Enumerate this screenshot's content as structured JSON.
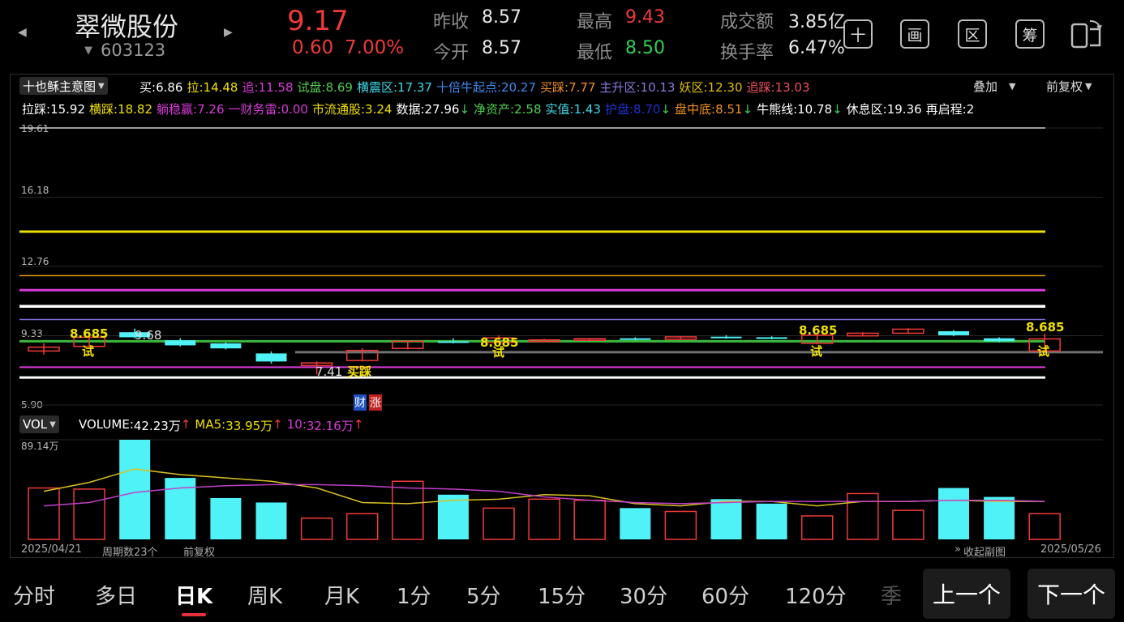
{
  "header": {
    "name": "翠微股份",
    "code": "603123",
    "price": "9.17",
    "change": "0.60",
    "change_pct": "7.00%",
    "quote": {
      "prev_close_label": "昨收",
      "prev_close": "8.57",
      "open_label": "今开",
      "open": "8.57",
      "high_label": "最高",
      "high": "9.43",
      "low_label": "最低",
      "low": "8.50",
      "turnover_amt_label": "成交额",
      "turnover_amt": "3.85亿",
      "turnover_rate_label": "换手率",
      "turnover_rate": "6.47%"
    },
    "tools": [
      "十",
      "画",
      "区",
      "筹"
    ]
  },
  "indicator": {
    "name": "十也稣主意图",
    "overlay": "叠加",
    "adjust": "前复权",
    "row1": [
      {
        "label": "买:",
        "value": "6.86",
        "color": "#ffffff"
      },
      {
        "label": "拉:",
        "value": "14.48",
        "color": "#f0e000"
      },
      {
        "label": "追:",
        "value": "11.58",
        "color": "#d83bd8"
      },
      {
        "label": "试盘:",
        "value": "8.69",
        "color": "#4fd04f"
      },
      {
        "label": "横震区:",
        "value": "17.37",
        "color": "#3fd8e8"
      },
      {
        "label": "十倍牛起点:",
        "value": "20.27",
        "color": "#3a8cf0"
      },
      {
        "label": "买踩:",
        "value": "7.77",
        "color": "#f09020"
      },
      {
        "label": "主升区:",
        "value": "10.13",
        "color": "#8a7ae0"
      },
      {
        "label": "妖区:",
        "value": "12.30",
        "color": "#e0c000"
      },
      {
        "label": "追踩:",
        "value": "13.03",
        "color": "#f05060"
      }
    ],
    "row2": [
      {
        "label": "拉踩:",
        "value": "15.92",
        "color": "#ffffff",
        "arrow": ""
      },
      {
        "label": "横踩:",
        "value": "18.82",
        "color": "#f0e000",
        "arrow": ""
      },
      {
        "label": "躺稳赢:",
        "value": "7.26",
        "color": "#d83bd8",
        "arrow": ""
      },
      {
        "label": "一财务雷:",
        "value": "0.00",
        "color": "#d83bd8",
        "arrow": ""
      },
      {
        "label": "市流通股:",
        "value": "3.24",
        "color": "#f0e000",
        "arrow": ""
      },
      {
        "label": "数据:",
        "value": "27.96",
        "color": "#ffffff",
        "arrow": "↓"
      },
      {
        "label": "净资产:",
        "value": "2.58",
        "color": "#4fd04f",
        "arrow": ""
      },
      {
        "label": "实值:",
        "value": "1.43",
        "color": "#3fd8e8",
        "arrow": ""
      },
      {
        "label": "护盘:",
        "value": "8.70",
        "color": "#2030d0",
        "arrow": "↓"
      },
      {
        "label": "盘中底:",
        "value": "8.51",
        "color": "#f09020",
        "arrow": "↓"
      },
      {
        "label": "牛熊线:",
        "value": "10.78",
        "color": "#ffffff",
        "arrow": "↓"
      },
      {
        "label": "休息区:",
        "value": "19.36",
        "color": "#ffffff",
        "arrow": ""
      },
      {
        "label": "再启程:",
        "value": "2",
        "color": "#ffffff",
        "arrow": ""
      }
    ]
  },
  "price_axis": [
    "19.61",
    "16.18",
    "12.76",
    "9.33",
    "5.90"
  ],
  "annotations": {
    "test_value": "8.685",
    "test_char": "试",
    "high_mark": "9.68",
    "low_mark": "7.41",
    "buy_step": "买踩",
    "fin_tag": "财",
    "rise_tag": "涨"
  },
  "volume": {
    "label": "VOL",
    "volume_label": "VOLUME:",
    "volume_value": "42.23万",
    "ma5_label": "MA5:",
    "ma5_value": "33.95万",
    "ma10_label": "10:",
    "ma10_value": "32.16万",
    "arrow": "↑",
    "max_label": "89.14万"
  },
  "footer": {
    "start_date": "2025/04/21",
    "period": "周期数23个",
    "adjust": "前复权",
    "collapse": "收起副图",
    "end_date": "2025/05/26"
  },
  "tabs": [
    "分时",
    "多日",
    "日K",
    "周K",
    "月K",
    "1分",
    "5分",
    "15分",
    "30分",
    "60分",
    "120分",
    "季"
  ],
  "active_tab": "日K",
  "nav": {
    "prev": "上一个",
    "next": "下一个"
  },
  "colors": {
    "up": "#f03a3a",
    "down": "#4ff2f6",
    "accent_yellow": "#f0e000",
    "ma_green": "#3cb83c"
  },
  "chart_data": {
    "type": "candlestick",
    "ylim": [
      5.9,
      19.61
    ],
    "candles": [
      {
        "o": 8.57,
        "c": 8.76,
        "h": 8.95,
        "l": 8.4,
        "up": true
      },
      {
        "o": 8.8,
        "c": 9.25,
        "h": 9.4,
        "l": 8.75,
        "up": true
      },
      {
        "o": 9.5,
        "c": 9.25,
        "h": 9.68,
        "l": 9.2,
        "up": false
      },
      {
        "o": 9.1,
        "c": 8.85,
        "h": 9.2,
        "l": 8.8,
        "up": false
      },
      {
        "o": 8.95,
        "c": 8.7,
        "h": 9.0,
        "l": 8.65,
        "up": false
      },
      {
        "o": 8.45,
        "c": 8.05,
        "h": 8.55,
        "l": 7.95,
        "up": false
      },
      {
        "o": 7.85,
        "c": 7.98,
        "h": 8.05,
        "l": 7.41,
        "up": true
      },
      {
        "o": 8.1,
        "c": 8.6,
        "h": 8.7,
        "l": 8.05,
        "up": true
      },
      {
        "o": 8.7,
        "c": 9.05,
        "h": 9.1,
        "l": 8.65,
        "up": true
      },
      {
        "o": 9.05,
        "c": 8.98,
        "h": 9.2,
        "l": 8.95,
        "up": false
      },
      {
        "o": 9.0,
        "c": 9.22,
        "h": 9.35,
        "l": 8.98,
        "up": true
      },
      {
        "o": 9.05,
        "c": 9.12,
        "h": 9.18,
        "l": 9.0,
        "up": true
      },
      {
        "o": 9.1,
        "c": 9.18,
        "h": 9.2,
        "l": 9.05,
        "up": true
      },
      {
        "o": 9.2,
        "c": 9.15,
        "h": 9.25,
        "l": 9.1,
        "up": false
      },
      {
        "o": 9.15,
        "c": 9.27,
        "h": 9.3,
        "l": 9.12,
        "up": true
      },
      {
        "o": 9.28,
        "c": 9.22,
        "h": 9.35,
        "l": 9.18,
        "up": false
      },
      {
        "o": 9.25,
        "c": 9.18,
        "h": 9.3,
        "l": 9.15,
        "up": false
      },
      {
        "o": 8.95,
        "c": 9.35,
        "h": 9.4,
        "l": 8.9,
        "up": true
      },
      {
        "o": 9.32,
        "c": 9.45,
        "h": 9.5,
        "l": 9.3,
        "up": true
      },
      {
        "o": 9.45,
        "c": 9.65,
        "h": 9.7,
        "l": 9.45,
        "up": true
      },
      {
        "o": 9.55,
        "c": 9.35,
        "h": 9.6,
        "l": 9.3,
        "up": false
      },
      {
        "o": 9.2,
        "c": 9.05,
        "h": 9.25,
        "l": 9.0,
        "up": false
      },
      {
        "o": 8.57,
        "c": 9.17,
        "h": 9.43,
        "l": 8.5,
        "up": true
      }
    ],
    "hlines": [
      {
        "value": 14.48,
        "color": "#e8e000",
        "width": 3
      },
      {
        "value": 12.3,
        "color": "#e8a000",
        "width": 1.5
      },
      {
        "value": 11.58,
        "color": "#d83bd8",
        "width": 3
      },
      {
        "value": 10.78,
        "color": "#ffffff",
        "width": 3.5
      },
      {
        "value": 10.13,
        "color": "#7a6ad8",
        "width": 1.5
      },
      {
        "value": 9.05,
        "color": "#3cb83c",
        "width": 3
      },
      {
        "value": 8.51,
        "color": "#707070",
        "width": 3
      },
      {
        "value": 7.77,
        "color": "#d83bd8",
        "width": 2
      },
      {
        "value": 7.26,
        "color": "#ffffff",
        "width": 3
      }
    ],
    "vol_max": 89.14,
    "volumes": [
      46,
      45,
      89.14,
      55,
      37,
      33,
      19,
      23,
      52,
      40,
      28,
      36,
      35,
      28,
      25,
      36,
      32,
      21,
      41,
      26,
      46,
      38,
      23,
      42.23
    ],
    "ma5": [
      43,
      51,
      63,
      58,
      55,
      52,
      46,
      33,
      32,
      35,
      36,
      40,
      39,
      32,
      30,
      34,
      34,
      30,
      34,
      34,
      35,
      34,
      34,
      33.95
    ],
    "ma10": [
      30,
      33,
      42,
      46,
      48,
      49,
      49,
      48,
      46,
      45,
      43,
      38,
      35,
      33,
      32,
      33,
      34,
      34,
      34,
      34,
      35,
      35,
      34,
      32.16
    ]
  }
}
